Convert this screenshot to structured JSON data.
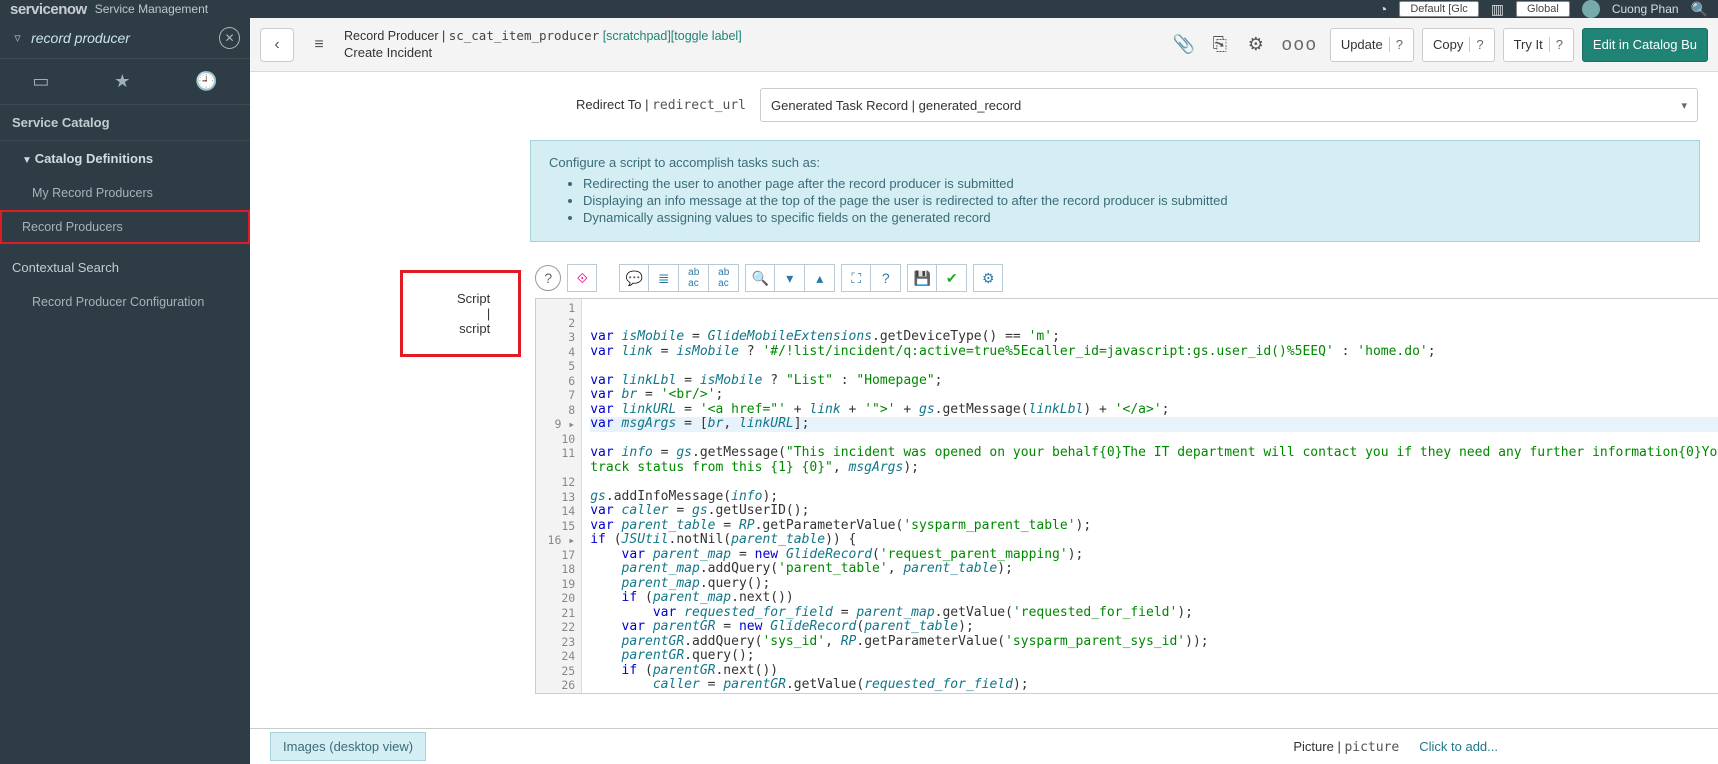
{
  "banner": {
    "logo": "servicenow",
    "product": "Service Management",
    "scope": "Default [Glc",
    "domain": "Global",
    "user": "Cuong Phan"
  },
  "nav": {
    "search_value": "record producer",
    "sections": {
      "service_catalog": "Service Catalog",
      "catalog_defs": "Catalog Definitions",
      "my_rp": "My Record Producers",
      "rp": "Record Producers",
      "ctx_search": "Contextual Search",
      "rp_config": "Record Producer Configuration"
    }
  },
  "header": {
    "title_pre": "Record Producer",
    "title_table": "sc_cat_item_producer",
    "link1": "[scratchpad]",
    "link2": "[toggle label]",
    "subtitle": "Create Incident",
    "btn_update": "Update",
    "btn_copy": "Copy",
    "btn_tryit": "Try It",
    "btn_edit": "Edit in Catalog Bu"
  },
  "form": {
    "redirect_label": "Redirect To",
    "redirect_field": "redirect_url",
    "redirect_value": "Generated Task Record | generated_record",
    "script_label": "Script",
    "script_field": "script"
  },
  "callout": {
    "intro": "Configure a script to accomplish tasks such as:",
    "b1": "Redirecting the user to another page after the record producer is submitted",
    "b2": "Displaying an info message at the top of the page the user is redirected to after the record producer is submitted",
    "b3": "Dynamically assigning values to specific fields on the generated record"
  },
  "editor": {
    "lines": [
      "1",
      "2",
      "3",
      "4",
      "5",
      "6",
      "7",
      "8",
      "9",
      "10",
      "11",
      "12",
      "13",
      "14",
      "15",
      "16",
      "17",
      "18",
      "19",
      "20",
      "21",
      "22",
      "23",
      "24",
      "25",
      "26"
    ]
  },
  "bottom": {
    "images_label": "Images (desktop view)",
    "picture_label": "Picture",
    "picture_field": "picture",
    "add_link": "Click to add..."
  }
}
